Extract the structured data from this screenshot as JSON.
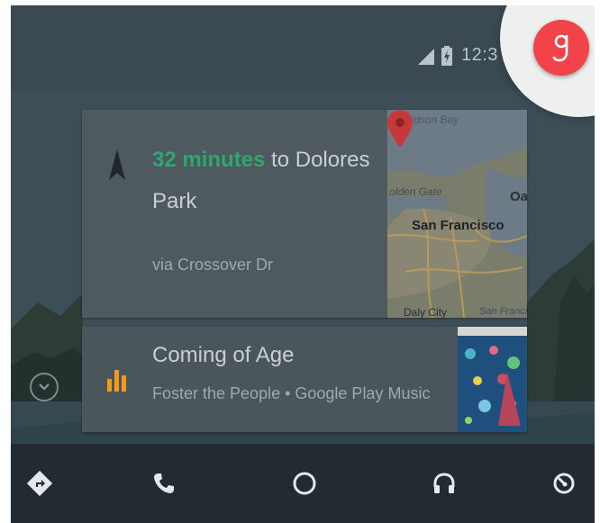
{
  "status_bar": {
    "clock": "12:3",
    "signal_icon": "signal-icon",
    "battery_icon": "battery-charging-icon"
  },
  "voice": {
    "icon": "google-g-icon",
    "color": "#f2434a"
  },
  "navigation_card": {
    "eta": "32 minutes",
    "destination_prefix": " to Dolores",
    "destination_rest": "Park",
    "via": "via Crossover Dr",
    "eta_color": "#2fa86e",
    "icon": "navigation-arrow-icon",
    "map": {
      "labels": {
        "bay": "ichardson Bay",
        "golden_gate": "olden Gate",
        "oakland": "Oa",
        "city": "San Francisco",
        "daly_city": "Daly City",
        "sf_south": "San Francis"
      }
    }
  },
  "music_card": {
    "title": "Coming of Age",
    "subtitle": "Foster the People • Google Play Music",
    "icon": "equalizer-bars-icon",
    "icon_color": "#f39a1e"
  },
  "expand": {
    "icon": "chevron-down-icon"
  },
  "bottom_nav": {
    "items": [
      {
        "name": "navigation",
        "icon": "directions-icon"
      },
      {
        "name": "phone",
        "icon": "phone-icon"
      },
      {
        "name": "home",
        "icon": "home-circle-icon"
      },
      {
        "name": "audio",
        "icon": "headphones-icon"
      },
      {
        "name": "exit",
        "icon": "exit-icon"
      }
    ]
  }
}
